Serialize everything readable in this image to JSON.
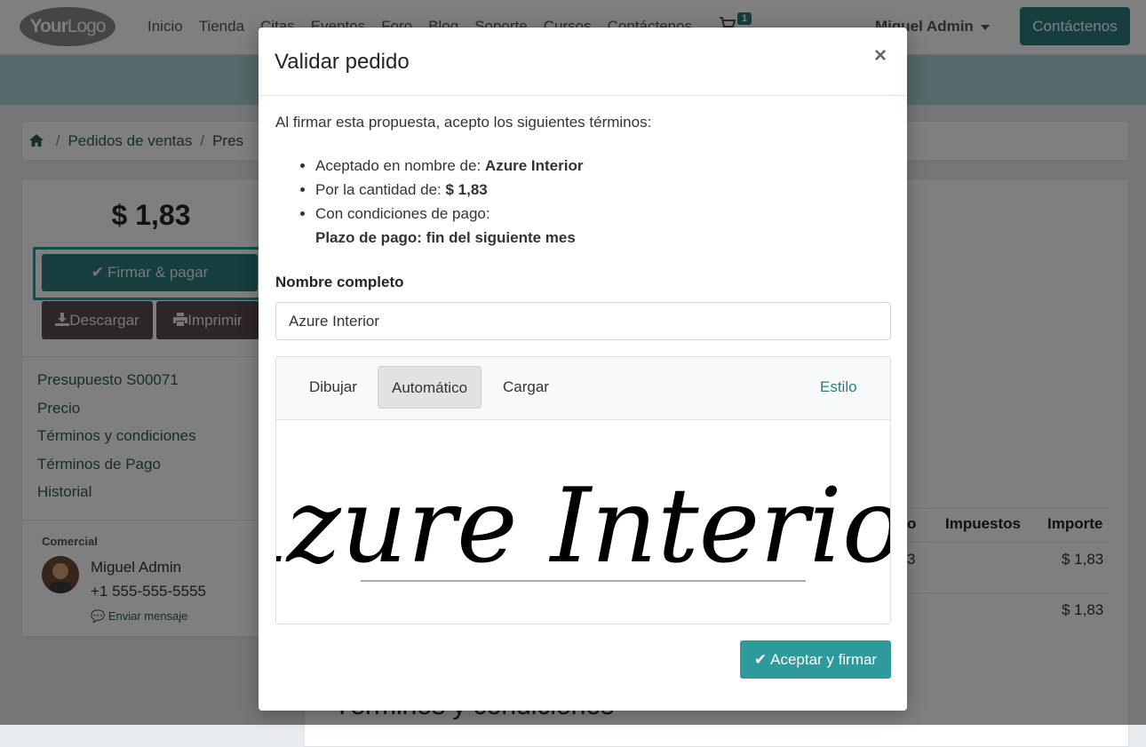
{
  "navbar": {
    "logo_bold": "Your",
    "logo_light": "Logo",
    "links": [
      "Inicio",
      "Tienda",
      "Citas",
      "Eventos",
      "Foro",
      "Blog",
      "Soporte",
      "Cursos",
      "Contáctenos"
    ],
    "cart_count": "1",
    "user": "Miguel Admin",
    "contact_button": "Contáctenos"
  },
  "breadcrumb": {
    "home_icon": "home-icon",
    "orders": "Pedidos de ventas",
    "current": "Pres"
  },
  "sidebar": {
    "total": "$ 1,83",
    "sign_pay": "Firmar & pagar",
    "download": "Descargar",
    "print": "Imprimir",
    "nav": [
      "Presupuesto S00071",
      "Precio",
      "Términos y condiciones",
      "Términos de Pago",
      "Historial"
    ],
    "salesperson_label": "Comercial",
    "salesperson_name": "Miguel Admin",
    "salesperson_phone": "+1 555-555-5555",
    "send_message": "Enviar mensaje"
  },
  "main": {
    "col_partial": "o",
    "col_taxes": "Impuestos",
    "col_amount": "Importe",
    "row_partial": "3",
    "row_amount": "$ 1,83",
    "subtotal": "$ 1,83",
    "section_title": "Términos y condiciones"
  },
  "modal": {
    "title": "Validar pedido",
    "close": "×",
    "intro": "Al firmar esta propuesta, acepto los siguientes términos:",
    "accepted_label": "Aceptado en nombre de: ",
    "accepted_value": "Azure Interior",
    "amount_label": "Por la cantidad de: ",
    "amount_value": "$ 1,83",
    "conditions_label": "Con condiciones de pago:",
    "conditions_value": "Plazo de pago: fin del siguiente mes",
    "name_label": "Nombre completo",
    "name_value": "Azure Interior",
    "tabs": [
      "Dibujar",
      "Automático",
      "Cargar"
    ],
    "active_tab": "Automático",
    "style_link": "Estilo",
    "signature_text": "Azure Interior",
    "accept_button": "Aceptar y firmar"
  },
  "colors": {
    "primary": "#2d7d7e",
    "accent_button": "#2e9a9b",
    "secondary_button": "#5a4a50",
    "highlight_border": "#17a2a3"
  }
}
